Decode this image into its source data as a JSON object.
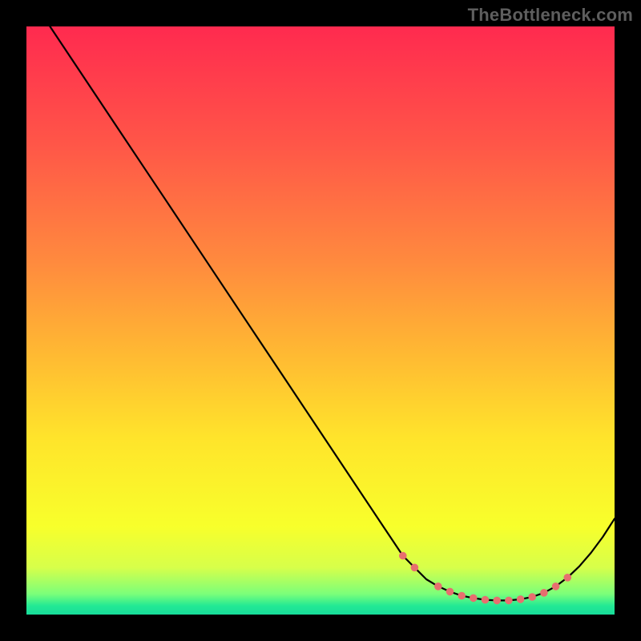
{
  "watermark": "TheBottleneck.com",
  "colors": {
    "gradient_stops": [
      {
        "offset": 0.0,
        "color": "#ff2a4f"
      },
      {
        "offset": 0.2,
        "color": "#ff5648"
      },
      {
        "offset": 0.4,
        "color": "#ff8a3e"
      },
      {
        "offset": 0.55,
        "color": "#ffb733"
      },
      {
        "offset": 0.7,
        "color": "#ffe42b"
      },
      {
        "offset": 0.85,
        "color": "#f8ff2b"
      },
      {
        "offset": 0.92,
        "color": "#d7ff4a"
      },
      {
        "offset": 0.965,
        "color": "#7bff7a"
      },
      {
        "offset": 0.985,
        "color": "#23e994"
      },
      {
        "offset": 1.0,
        "color": "#18dc9a"
      }
    ],
    "marker": "#e76f6f"
  },
  "chart_data": {
    "type": "line",
    "title": "",
    "xlabel": "",
    "ylabel": "",
    "xlim": [
      0,
      100
    ],
    "ylim": [
      0,
      100
    ],
    "x": [
      0,
      4,
      8,
      12,
      16,
      20,
      24,
      28,
      32,
      36,
      40,
      44,
      48,
      52,
      56,
      60,
      62,
      64,
      66,
      68,
      70,
      72,
      74,
      76,
      78,
      80,
      82,
      84,
      86,
      88,
      90,
      92,
      94,
      96,
      98,
      100
    ],
    "y": [
      108,
      100,
      94,
      88,
      82,
      76,
      70,
      64,
      58,
      52,
      46,
      40,
      34,
      28,
      22,
      16,
      13,
      10,
      8,
      6,
      4.8,
      3.9,
      3.2,
      2.8,
      2.5,
      2.4,
      2.4,
      2.6,
      3.0,
      3.7,
      4.8,
      6.3,
      8.2,
      10.5,
      13.2,
      16.3
    ],
    "markers_x": [
      64,
      66,
      70,
      72,
      74,
      76,
      78,
      80,
      82,
      84,
      86,
      88,
      90,
      92
    ],
    "markers_y": [
      10.0,
      8.0,
      4.8,
      3.9,
      3.2,
      2.8,
      2.5,
      2.4,
      2.4,
      2.6,
      3.0,
      3.7,
      4.8,
      6.3
    ]
  }
}
